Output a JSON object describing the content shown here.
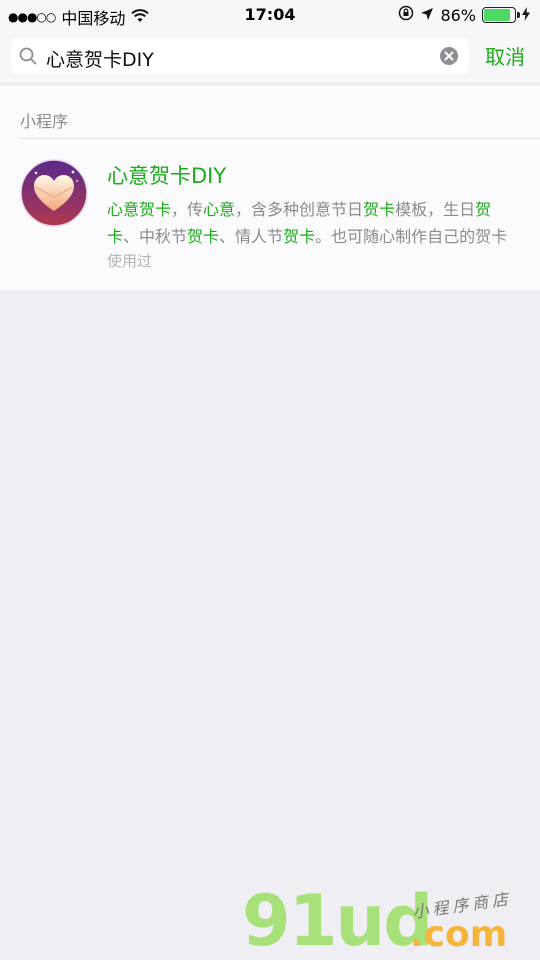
{
  "status_bar": {
    "signal_dots": "●●●○○",
    "carrier": "中国移动",
    "wifi_icon": "wifi-icon",
    "time": "17:04",
    "battery_percent": "86%",
    "battery_level": 0.86
  },
  "search": {
    "query": "心意贺卡DIY",
    "cancel_label": "取消"
  },
  "results": {
    "section_title": "小程序",
    "item": {
      "name": "心意贺卡DIY",
      "desc_parts": [
        {
          "t": "心意贺卡",
          "hl": true
        },
        {
          "t": "，传",
          "hl": false
        },
        {
          "t": "心意",
          "hl": true
        },
        {
          "t": "，含多种创意节日",
          "hl": false
        },
        {
          "t": "贺卡",
          "hl": true
        },
        {
          "t": "模板，生日",
          "hl": false
        },
        {
          "t": "贺卡",
          "hl": true
        },
        {
          "t": "、中秋节",
          "hl": false
        },
        {
          "t": "贺卡",
          "hl": true
        },
        {
          "t": "、情人节",
          "hl": false
        },
        {
          "t": "贺卡",
          "hl": true
        },
        {
          "t": "。也可随心制作自己的贺卡",
          "hl": false
        }
      ],
      "used_tag": "使用过"
    }
  },
  "watermark": {
    "main": "91ud",
    "domain": ".com",
    "tagline": "小程序商店"
  },
  "colors": {
    "accent": "#1aad19",
    "background": "#efeef3"
  }
}
